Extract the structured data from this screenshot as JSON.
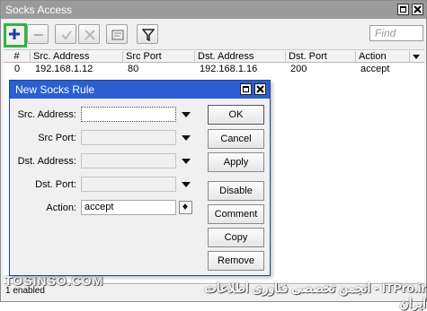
{
  "window": {
    "title": "Socks Access"
  },
  "toolbar": {
    "find_placeholder": "Find"
  },
  "table": {
    "columns": [
      "#",
      "Src. Address",
      "Src Port",
      "Dst. Address",
      "Dst. Port",
      "Action"
    ],
    "rows": [
      {
        "num": "0",
        "src_address": "192.168.1.12",
        "src_port": "80",
        "dst_address": "192.168.1.16",
        "dst_port": "200",
        "action": "accept"
      }
    ]
  },
  "status": {
    "text": "1 enabled"
  },
  "dialog": {
    "title": "New Socks Rule",
    "fields": {
      "src_address": {
        "label": "Src. Address:",
        "value": ""
      },
      "src_port": {
        "label": "Src Port:",
        "value": ""
      },
      "dst_address": {
        "label": "Dst. Address:",
        "value": ""
      },
      "dst_port": {
        "label": "Dst. Port:",
        "value": ""
      },
      "action": {
        "label": "Action:",
        "value": "accept"
      }
    },
    "buttons": {
      "ok": "OK",
      "cancel": "Cancel",
      "apply": "Apply",
      "disable": "Disable",
      "comment": "Comment",
      "copy": "Copy",
      "remove": "Remove"
    }
  },
  "watermark": {
    "left": "TOSINSO.COM",
    "right": "ITPro.ir - انجمن تخصصی فناوری اطلاعات ایران"
  },
  "colors": {
    "highlight": "#34b340",
    "dialog_title": "#2b5ed0",
    "window_title": "#9b9b9b"
  }
}
